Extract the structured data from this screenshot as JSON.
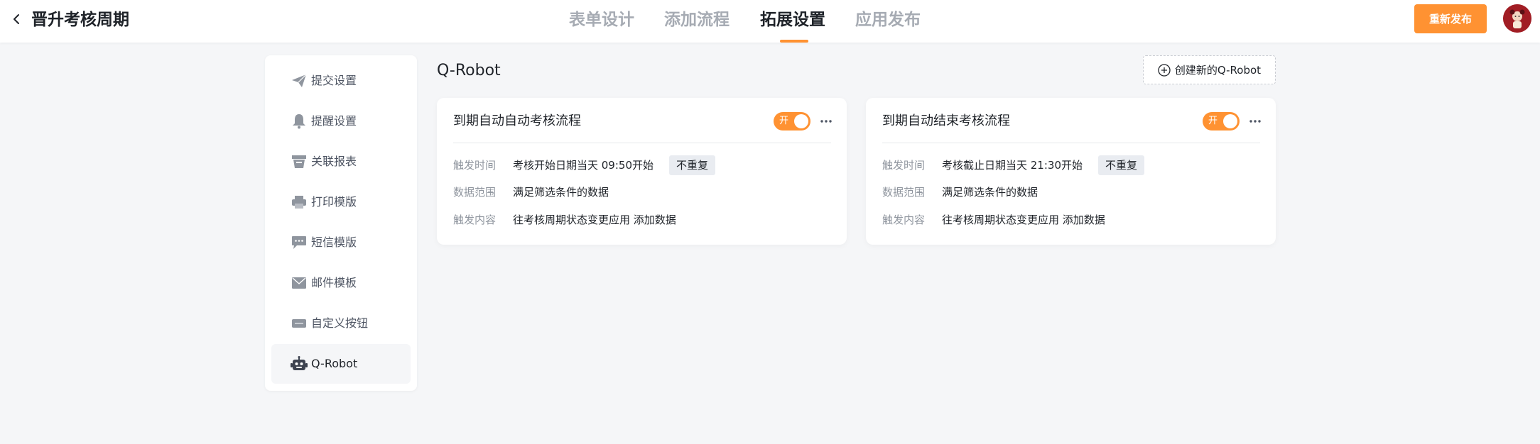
{
  "header": {
    "title": "晋升考核周期",
    "tabs": [
      {
        "label": "表单设计"
      },
      {
        "label": "添加流程"
      },
      {
        "label": "拓展设置"
      },
      {
        "label": "应用发布"
      }
    ],
    "active_tab": "拓展设置",
    "republish_label": "重新发布"
  },
  "sidebar": {
    "items": [
      {
        "label": "提交设置",
        "icon": "send-icon"
      },
      {
        "label": "提醒设置",
        "icon": "bell-icon"
      },
      {
        "label": "关联报表",
        "icon": "report-icon"
      },
      {
        "label": "打印模版",
        "icon": "printer-icon"
      },
      {
        "label": "短信模版",
        "icon": "message-icon"
      },
      {
        "label": "邮件模板",
        "icon": "mail-icon"
      },
      {
        "label": "自定义按钮",
        "icon": "button-icon"
      },
      {
        "label": "Q-Robot",
        "icon": "robot-icon"
      }
    ],
    "active_item": "Q-Robot"
  },
  "main": {
    "title": "Q-Robot",
    "create_button_label": "创建新的Q-Robot",
    "cards": [
      {
        "title": "到期自动自动考核流程",
        "toggle_label": "开",
        "enabled": true,
        "rows": [
          {
            "label": "触发时间",
            "value": "考核开始日期当天 09:50开始",
            "tag": "不重复"
          },
          {
            "label": "数据范围",
            "value": "满足筛选条件的数据"
          },
          {
            "label": "触发内容",
            "value": "往考核周期状态变更应用 添加数据"
          }
        ]
      },
      {
        "title": "到期自动结束考核流程",
        "toggle_label": "开",
        "enabled": true,
        "rows": [
          {
            "label": "触发时间",
            "value": "考核截止日期当天 21:30开始",
            "tag": "不重复"
          },
          {
            "label": "数据范围",
            "value": "满足筛选条件的数据"
          },
          {
            "label": "触发内容",
            "value": "往考核周期状态变更应用 添加数据"
          }
        ]
      }
    ]
  },
  "colors": {
    "accent": "#ff9232",
    "page_bg": "#f5f6f8",
    "text_primary": "#1f2329",
    "text_secondary": "#8f959e",
    "tab_inactive": "#a6abb3",
    "tag_bg": "#e9ecf1",
    "avatar_bg": "#a11d24"
  }
}
